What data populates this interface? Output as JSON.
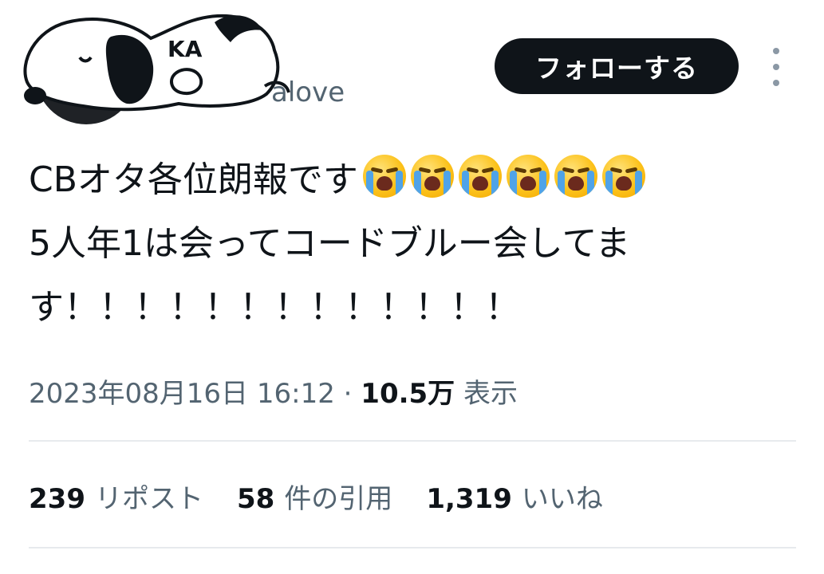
{
  "header": {
    "display_name_fragment": "KA",
    "handle_fragment": "alove",
    "follow_label": "フォローする"
  },
  "tweet": {
    "line1_text": "CBオタ各位朗報です",
    "line1_emoji": "loudly-crying-face",
    "line1_emoji_count": 6,
    "line2_text": "5人年1は会ってコードブルー会してま",
    "line3_text": "す！！！！！！！！！！！！！"
  },
  "meta": {
    "timestamp": "2023年08月16日 16:12",
    "separator": " · ",
    "views_count": "10.5万",
    "views_label": " 表示"
  },
  "stats": {
    "reposts_count": "239",
    "reposts_label": "リポスト",
    "quotes_count": "58",
    "quotes_label": "件の引用",
    "likes_count": "1,319",
    "likes_label": "いいね"
  },
  "colors": {
    "text_primary": "#0f1419",
    "text_secondary": "#536471",
    "follow_button_bg": "#0f1419",
    "divider": "#e7eaed"
  }
}
